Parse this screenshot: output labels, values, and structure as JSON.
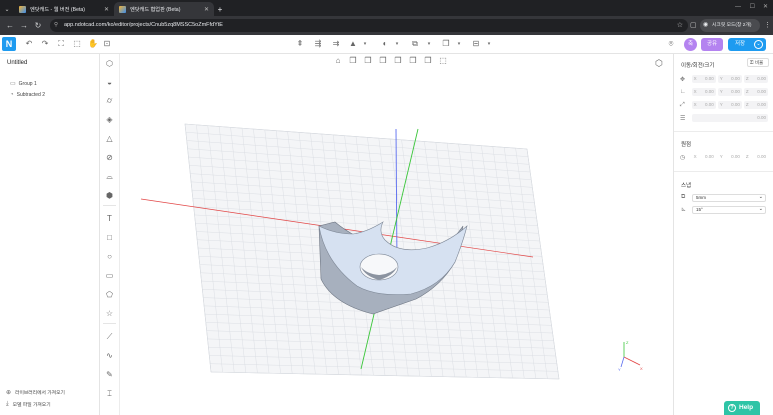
{
  "browser": {
    "tabs": [
      {
        "title": "엔닷캐드 - 웹 버전 (Beta)"
      },
      {
        "title": "엔닷캐드 협업판 (Beta)"
      }
    ],
    "url": "app.ndotcad.com/ko/editor/projects/Cnub5zq8MSSC5oZmFfdYtE",
    "profile_label": "시크릿 모드(창 2개)"
  },
  "app": {
    "logo_letter": "N",
    "avatar_letter": "축",
    "share_label": "공유",
    "save_label": "저장"
  },
  "left_panel": {
    "project_title": "Untitled",
    "tree": [
      {
        "label": "Group 1"
      },
      {
        "label": "Subtracted 2"
      }
    ],
    "footer": [
      {
        "label": "라이브러리에서 가져오기"
      },
      {
        "label": "모델 파일 가져오기"
      }
    ]
  },
  "right_panel": {
    "transform_title": "이동/회전/크기",
    "lock_label": "비율",
    "transform_rows": [
      {
        "fields": [
          {
            "axis": "X",
            "value": "0.00"
          },
          {
            "axis": "Y",
            "value": "0.00"
          },
          {
            "axis": "Z",
            "value": "0.00"
          }
        ]
      },
      {
        "fields": [
          {
            "axis": "X",
            "value": "0.00"
          },
          {
            "axis": "Y",
            "value": "0.00"
          },
          {
            "axis": "Z",
            "value": "0.00"
          }
        ]
      },
      {
        "fields": [
          {
            "axis": "X",
            "value": "0.00"
          },
          {
            "axis": "Y",
            "value": "0.00"
          },
          {
            "axis": "Z",
            "value": "0.00"
          }
        ]
      },
      {
        "fields": [
          {
            "axis": "",
            "value": "0.00"
          }
        ]
      }
    ],
    "origin_title": "원점",
    "origin_fields": [
      {
        "axis": "X",
        "value": "0.00"
      },
      {
        "axis": "Y",
        "value": "0.00"
      },
      {
        "axis": "Z",
        "value": "0.00"
      }
    ],
    "snap_title": "스냅",
    "snap_move": "5mm",
    "snap_rotate": "15°"
  },
  "help_label": "Help",
  "colors": {
    "accent": "#1e9bf0",
    "avatar": "#b483f0",
    "help": "#2ec4a6",
    "axis_x": "#e24646",
    "axis_y": "#3ac63a",
    "axis_z": "#5a6cf0"
  }
}
